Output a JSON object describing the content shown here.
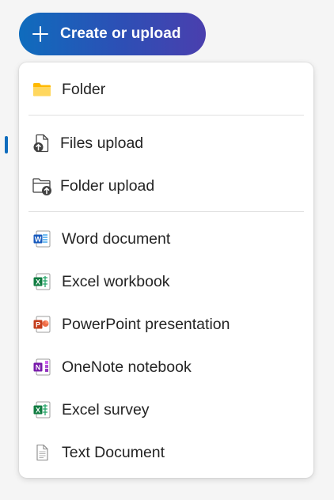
{
  "create_button": {
    "label": "Create or upload"
  },
  "menu": {
    "new": [
      {
        "label": "Folder",
        "icon": "folder-icon"
      }
    ],
    "upload": [
      {
        "label": "Files upload",
        "icon": "file-upload-icon"
      },
      {
        "label": "Folder upload",
        "icon": "folder-upload-icon"
      }
    ],
    "documents": [
      {
        "label": "Word document",
        "icon": "word-icon"
      },
      {
        "label": "Excel workbook",
        "icon": "excel-icon"
      },
      {
        "label": "PowerPoint presentation",
        "icon": "powerpoint-icon"
      },
      {
        "label": "OneNote notebook",
        "icon": "onenote-icon"
      },
      {
        "label": "Excel survey",
        "icon": "excel-survey-icon"
      },
      {
        "label": "Text Document",
        "icon": "text-document-icon"
      }
    ]
  },
  "colors": {
    "accent": "#0f6cbd",
    "word": "#185abd",
    "excel": "#107c41",
    "powerpoint": "#c43e1c",
    "onenote": "#7719aa",
    "folder": "#ffc83d"
  }
}
